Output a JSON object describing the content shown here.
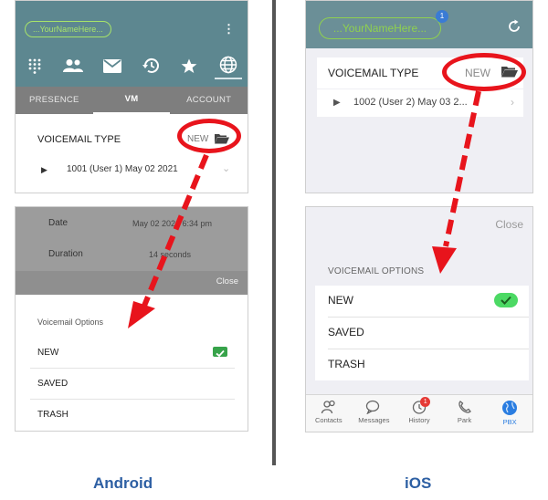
{
  "android": {
    "caption": "Android",
    "header": {
      "account_pill": "...YourNameHere..."
    },
    "tabs": [
      "PRESENCE",
      "VM",
      "ACCOUNT"
    ],
    "voicemail_type_label": "VOICEMAIL TYPE",
    "voicemail_type_value": "NEW",
    "voicemail_item": "1001 (User 1) May 02 2021",
    "details": {
      "date_label": "Date",
      "date_value": "May 02 2021 6:34 pm",
      "duration_label": "Duration",
      "duration_value": "14 seconds"
    },
    "close_label": "Close",
    "options_title": "Voicemail Options",
    "options": [
      "NEW",
      "SAVED",
      "TRASH"
    ]
  },
  "ios": {
    "caption": "iOS",
    "header": {
      "account_pill": "...YourNameHere...",
      "badge": "1"
    },
    "voicemail_type_label": "VOICEMAIL TYPE",
    "voicemail_type_value": "NEW",
    "voicemail_item": "1002 (User 2) May 03 2...",
    "close_label": "Close",
    "options_title": "VOICEMAIL OPTIONS",
    "options": [
      "NEW",
      "SAVED",
      "TRASH"
    ],
    "tabbar": {
      "contacts": "Contacts",
      "messages": "Messages",
      "history": "History",
      "history_badge": "1",
      "park": "Park",
      "pbx": "PBX"
    }
  },
  "colors": {
    "annotation": "#e8141c",
    "caption": "#2d5fa3",
    "android_header": "#5d8790",
    "ios_header": "#6b8f97",
    "check_android": "#37a34a",
    "check_ios": "#4cd964"
  },
  "icons": [
    "dialpad-icon",
    "contacts-icon",
    "mail-icon",
    "history-icon",
    "star-icon",
    "globe-icon",
    "folder-icon",
    "play-icon",
    "chevron-icon",
    "refresh-icon",
    "check-icon",
    "kebab-menu-icon"
  ]
}
